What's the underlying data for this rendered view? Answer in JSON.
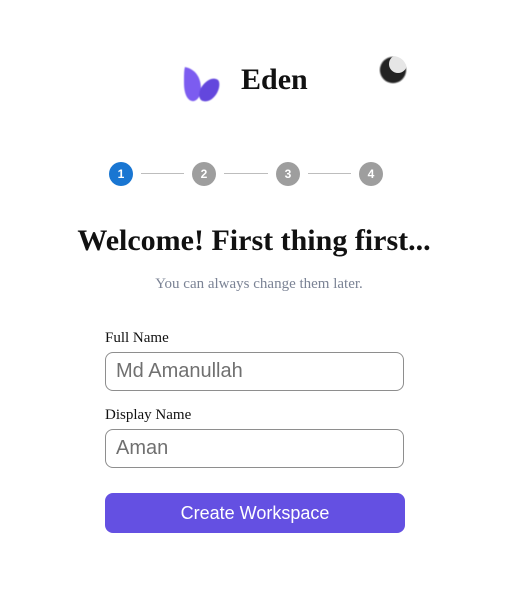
{
  "brand": {
    "name": "Eden",
    "logo_icon": "leaf-logo-icon",
    "logo_colors": [
      "#7c5cf0",
      "#5b3fd6"
    ]
  },
  "theme_toggle": {
    "icon": "moon-icon",
    "color": "#222222"
  },
  "stepper": {
    "current_step": 1,
    "steps": [
      {
        "label": "1",
        "state": "active"
      },
      {
        "label": "2",
        "state": "inactive"
      },
      {
        "label": "3",
        "state": "inactive"
      },
      {
        "label": "4",
        "state": "inactive"
      }
    ],
    "active_color": "#1976d2",
    "inactive_color": "#9e9e9e"
  },
  "heading": {
    "title": "Welcome! First thing first...",
    "subtitle": "You can always change them later."
  },
  "form": {
    "full_name": {
      "label": "Full Name",
      "placeholder": "Md Amanullah",
      "value": ""
    },
    "display_name": {
      "label": "Display Name",
      "placeholder": "Aman",
      "value": ""
    },
    "submit": {
      "label": "Create Workspace",
      "color": "#6450e2"
    }
  }
}
